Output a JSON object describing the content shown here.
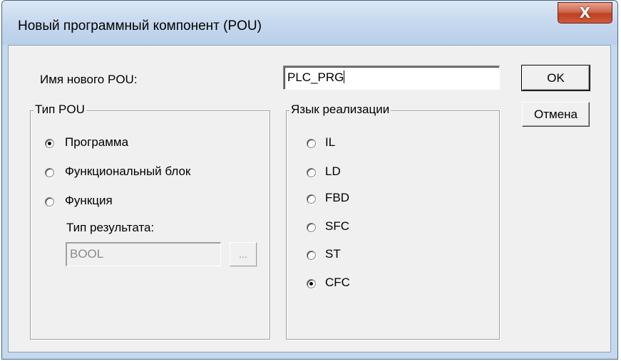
{
  "window": {
    "title": "Новый программный компонент (POU)",
    "close_glyph": "X"
  },
  "name_label": "Имя нового POU:",
  "name_value": "PLC_PRG",
  "buttons": {
    "ok": "OK",
    "cancel": "Отмена"
  },
  "pou_type": {
    "caption": "Тип POU",
    "options": [
      {
        "label": "Программа",
        "checked": true
      },
      {
        "label": "Функциональный блок",
        "checked": false
      },
      {
        "label": "Функция",
        "checked": false
      }
    ],
    "result_type_label": "Тип результата:",
    "result_type_value": "BOOL",
    "browse_label": "..."
  },
  "language": {
    "caption": "Язык реализации",
    "options": [
      {
        "label": "IL",
        "checked": false
      },
      {
        "label": "LD",
        "checked": false
      },
      {
        "label": "FBD",
        "checked": false
      },
      {
        "label": "SFC",
        "checked": false
      },
      {
        "label": "ST",
        "checked": false
      },
      {
        "label": "CFC",
        "checked": true
      }
    ]
  },
  "colors": {
    "titlebar": "#c4d7ee",
    "close": "#c8472a",
    "client": "#f0f0f0"
  }
}
